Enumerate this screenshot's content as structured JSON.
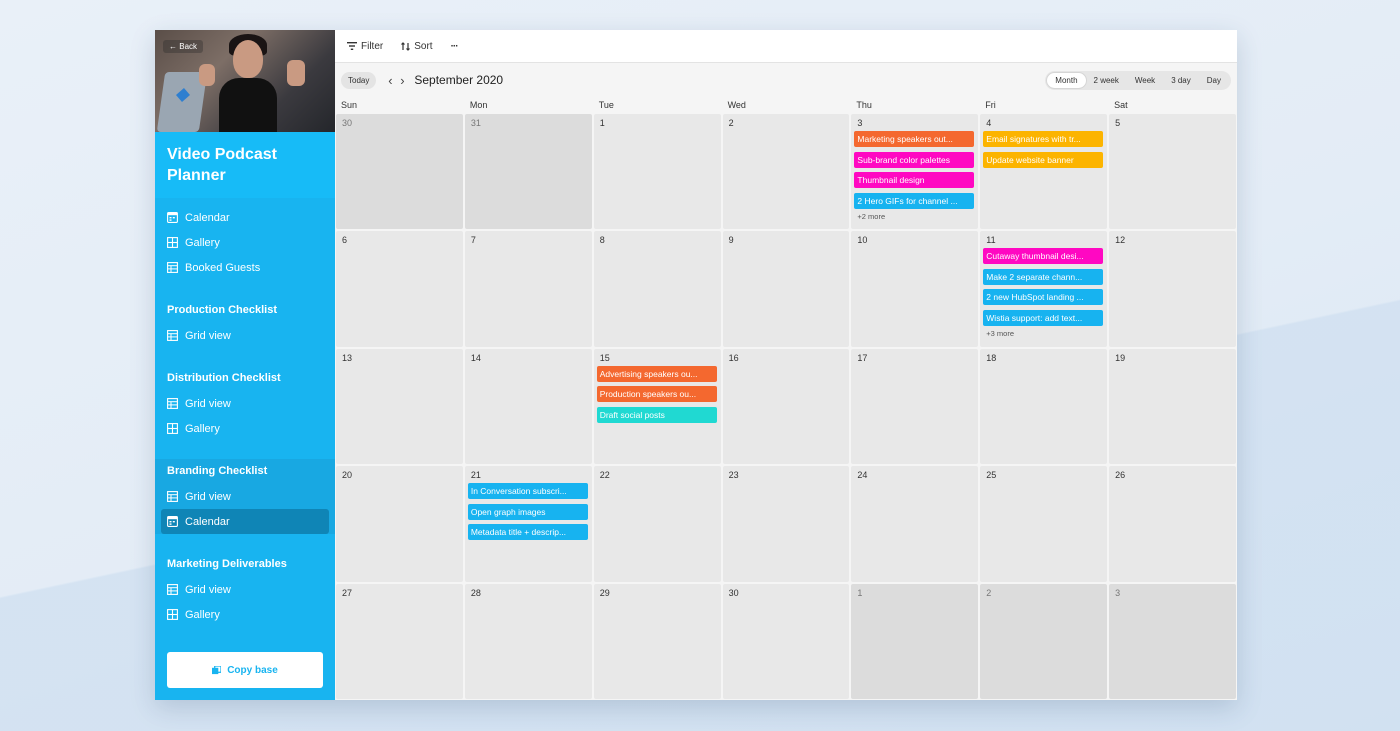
{
  "colors": {
    "sidebar": "#18b4f0",
    "orange": "#f4682f",
    "magenta": "#ff08c2",
    "blue": "#17b3f0",
    "amber": "#fcb400",
    "teal": "#20d9d2"
  },
  "sidebar": {
    "back_label": "Back",
    "base_title": "Video Podcast Planner",
    "groups": [
      {
        "title": "",
        "items": [
          {
            "icon": "calendar-icon",
            "label": "Calendar"
          },
          {
            "icon": "gallery-icon",
            "label": "Gallery"
          },
          {
            "icon": "grid-icon",
            "label": "Booked Guests"
          }
        ]
      },
      {
        "title": "Production Checklist",
        "items": [
          {
            "icon": "grid-icon",
            "label": "Grid view"
          }
        ]
      },
      {
        "title": "Distribution Checklist",
        "items": [
          {
            "icon": "grid-icon",
            "label": "Grid view"
          },
          {
            "icon": "gallery-icon",
            "label": "Gallery"
          }
        ]
      },
      {
        "title": "Branding Checklist",
        "items": [
          {
            "icon": "grid-icon",
            "label": "Grid view"
          },
          {
            "icon": "calendar-icon",
            "label": "Calendar",
            "active": true
          }
        ]
      },
      {
        "title": "Marketing Deliverables",
        "items": [
          {
            "icon": "grid-icon",
            "label": "Grid view"
          },
          {
            "icon": "gallery-icon",
            "label": "Gallery"
          }
        ]
      }
    ],
    "copy_label": "Copy base"
  },
  "toolbar": {
    "filter_label": "Filter",
    "sort_label": "Sort",
    "more_label": "···"
  },
  "calendar": {
    "today_label": "Today",
    "month_label": "September 2020",
    "views": [
      "Month",
      "2 week",
      "Week",
      "3 day",
      "Day"
    ],
    "selected_view": "Month",
    "weekdays": [
      "Sun",
      "Mon",
      "Tue",
      "Wed",
      "Thu",
      "Fri",
      "Sat"
    ],
    "weeks": [
      [
        {
          "day": "30",
          "other": true,
          "events": []
        },
        {
          "day": "31",
          "other": true,
          "events": []
        },
        {
          "day": "1",
          "events": []
        },
        {
          "day": "2",
          "events": []
        },
        {
          "day": "3",
          "events": [
            {
              "label": "Marketing speakers out...",
              "color": "orange"
            },
            {
              "label": "Sub-brand color palettes",
              "color": "magenta"
            },
            {
              "label": "Thumbnail design",
              "color": "magenta"
            },
            {
              "label": "2 Hero GIFs for channel ...",
              "color": "blue"
            }
          ],
          "more": "+2 more"
        },
        {
          "day": "4",
          "events": [
            {
              "label": "Email signatures with tr...",
              "color": "amber"
            },
            {
              "label": "Update website banner",
              "color": "amber"
            }
          ]
        },
        {
          "day": "5",
          "events": []
        }
      ],
      [
        {
          "day": "6",
          "events": []
        },
        {
          "day": "7",
          "events": []
        },
        {
          "day": "8",
          "events": []
        },
        {
          "day": "9",
          "events": []
        },
        {
          "day": "10",
          "events": []
        },
        {
          "day": "11",
          "events": [
            {
              "label": "Cutaway thumbnail desi...",
              "color": "magenta"
            },
            {
              "label": "Make 2 separate chann...",
              "color": "blue"
            },
            {
              "label": "2 new HubSpot landing ...",
              "color": "blue"
            },
            {
              "label": "Wistia support: add text...",
              "color": "blue"
            }
          ],
          "more": "+3 more"
        },
        {
          "day": "12",
          "events": []
        }
      ],
      [
        {
          "day": "13",
          "events": []
        },
        {
          "day": "14",
          "events": []
        },
        {
          "day": "15",
          "events": [
            {
              "label": "Advertising speakers ou...",
              "color": "orange"
            },
            {
              "label": "Production speakers ou...",
              "color": "orange"
            },
            {
              "label": "Draft social posts",
              "color": "teal"
            }
          ]
        },
        {
          "day": "16",
          "events": []
        },
        {
          "day": "17",
          "events": []
        },
        {
          "day": "18",
          "events": []
        },
        {
          "day": "19",
          "events": []
        }
      ],
      [
        {
          "day": "20",
          "events": []
        },
        {
          "day": "21",
          "events": [
            {
              "label": "In Conversation subscri...",
              "color": "blue"
            },
            {
              "label": "Open graph images",
              "color": "blue"
            },
            {
              "label": "Metadata title + descrip...",
              "color": "blue"
            }
          ]
        },
        {
          "day": "22",
          "events": []
        },
        {
          "day": "23",
          "events": []
        },
        {
          "day": "24",
          "events": []
        },
        {
          "day": "25",
          "events": []
        },
        {
          "day": "26",
          "events": []
        }
      ],
      [
        {
          "day": "27",
          "events": []
        },
        {
          "day": "28",
          "events": []
        },
        {
          "day": "29",
          "events": []
        },
        {
          "day": "30",
          "events": []
        },
        {
          "day": "1",
          "other": true,
          "events": []
        },
        {
          "day": "2",
          "other": true,
          "events": []
        },
        {
          "day": "3",
          "other": true,
          "events": []
        }
      ]
    ]
  }
}
